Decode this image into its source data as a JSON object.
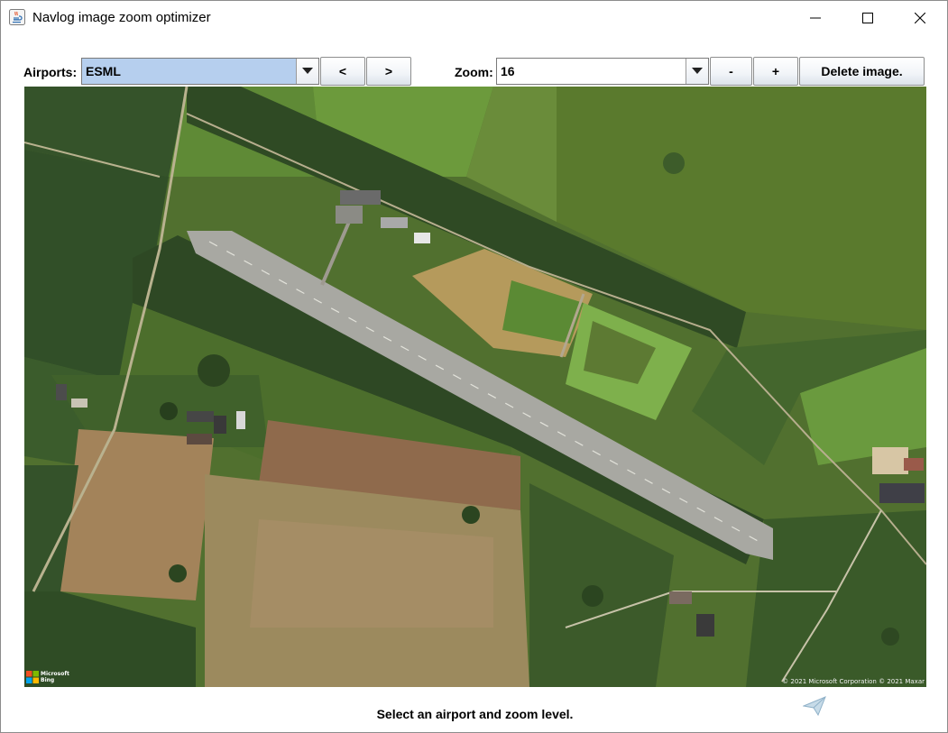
{
  "window": {
    "title": "Navlog image zoom optimizer"
  },
  "toolbar": {
    "airports_label": "Airports:",
    "airport_value": "ESML",
    "prev_label": "<",
    "next_label": ">",
    "zoom_label": "Zoom:",
    "zoom_value": "16",
    "zoom_out_label": "-",
    "zoom_in_label": "+",
    "delete_label": "Delete image."
  },
  "map": {
    "attribution_logo": "Microsoft Bing",
    "attribution_logo_line1": "Microsoft",
    "attribution_logo_line2": "Bing",
    "copyright": "© 2021 Microsoft Corporation © 2021 Maxar"
  },
  "status": {
    "message": "Select an airport and zoom level."
  },
  "colors": {
    "selection": "#b6cfee",
    "field_dark": "#3f5a28",
    "field_light": "#5e8a32",
    "runway": "#a7a7a2",
    "ploughed": "#a08058"
  },
  "icons": [
    "java-app-icon",
    "minimize-icon",
    "maximize-icon",
    "close-icon",
    "chevron-down-icon",
    "paper-plane-icon",
    "microsoft-logo-icon"
  ]
}
